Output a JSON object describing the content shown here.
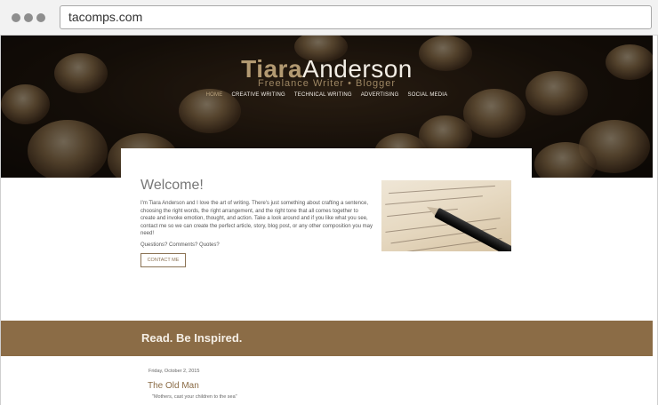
{
  "browser": {
    "url": "tacomps.com"
  },
  "logo": {
    "first": "Tiara",
    "last": "Anderson",
    "tagline": "Freelance Writer  •  Blogger"
  },
  "nav": {
    "items": [
      "HOME",
      "CREATIVE WRITING",
      "TECHNICAL WRITING",
      "ADVERTISING",
      "SOCIAL MEDIA"
    ],
    "active": "HOME"
  },
  "welcome": {
    "title": "Welcome!",
    "intro": "I'm Tiara Anderson and I love the art of writing. There's just something about crafting a sentence, choosing the right words, the right arrangement, and the right tone that all comes together to create and invoke emotion, thought, and action. Take a look around and if you like what you see, contact me so we can create the perfect article, story, blog post, or any other composition you may need!",
    "questions": "Questions? Comments? Quotes?",
    "contact_button": "CONTACT ME"
  },
  "inspired": {
    "title": "Read. Be Inspired."
  },
  "post": {
    "date": "Friday, October 2, 2015",
    "title": "The Old Man",
    "excerpt": "\"Mothers, cast your children to the sea\""
  },
  "colors": {
    "accent": "#8b6c46",
    "logo_gold": "#b39a72"
  }
}
